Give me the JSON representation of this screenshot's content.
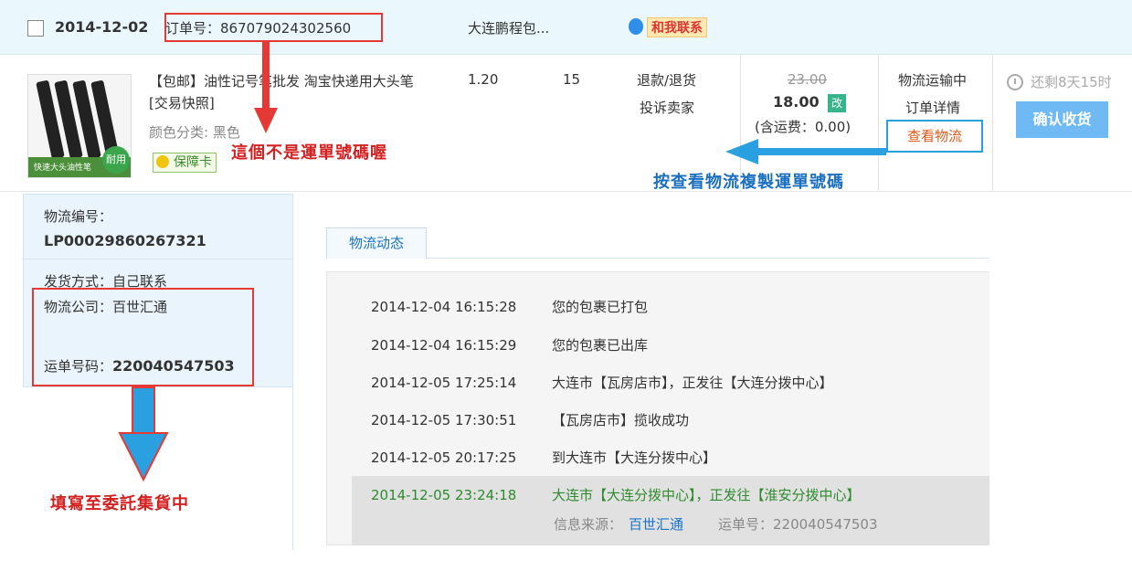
{
  "order": {
    "date": "2014-12-02",
    "order_no": "订单号：867079024302560",
    "seller": "大连鹏程包...",
    "contact_label": "和我联系",
    "product": {
      "title": "【包邮】油性记号笔批发 淘宝快递用大头笔 [交易快照]",
      "variant": "颜色分类: 黑色",
      "guarantee": "保障卡",
      "image_badge": "耐用",
      "image_caption": "快速大头油性笔"
    },
    "unit_price": "1.20",
    "quantity": "15",
    "refund_link": "退款/退货",
    "complain_link": "投诉卖家",
    "original_price": "23.00",
    "actual_price": "18.00",
    "modified_tag": "改",
    "shipping_fee": "(含运费：0.00)",
    "status": "物流运输中",
    "detail_link": "订单详情",
    "view_logistics": "查看物流",
    "remaining": "还剩8天15时",
    "confirm_button": "确认收货"
  },
  "annotations": {
    "not_waybill": "這個不是運單號碼喔",
    "copy_waybill": "按查看物流複製運單號碼",
    "fill_in": "填寫至委託集貨中"
  },
  "logistics_info": {
    "logistics_no_label": "物流编号：",
    "logistics_no": "LP00029860267321",
    "shipping_method": "发货方式：自己联系",
    "company": "物流公司：百世汇通",
    "waybill_label": "运单号码：",
    "waybill_no": "220040547503"
  },
  "tracking": {
    "tab_label": "物流动态",
    "events": [
      {
        "time": "2014-12-04 16:15:28",
        "desc": "您的包裹已打包"
      },
      {
        "time": "2014-12-04 16:15:29",
        "desc": "您的包裹已出库"
      },
      {
        "time": "2014-12-05 17:25:14",
        "desc": "大连市【瓦房店市】，正发往【大连分拨中心】"
      },
      {
        "time": "2014-12-05 17:30:51",
        "desc": "【瓦房店市】揽收成功"
      },
      {
        "time": "2014-12-05 20:17:25",
        "desc": "到大连市【大连分拨中心】"
      },
      {
        "time": "2014-12-05 23:24:18",
        "desc": "大连市【大连分拨中心】，正发往【淮安分拨中心】"
      }
    ],
    "source_label": "信息来源：",
    "source_company": "百世汇通",
    "waybill_label": "运单号：220040547503"
  },
  "colors": {
    "header_bg": "#eaf8fe",
    "annotation_red": "#d32020",
    "annotation_blue": "#1a6fc0",
    "arrow_blue": "#2aa0e0",
    "confirm_button": "#6fbaf5",
    "latest_event": "#2e8b2e"
  }
}
